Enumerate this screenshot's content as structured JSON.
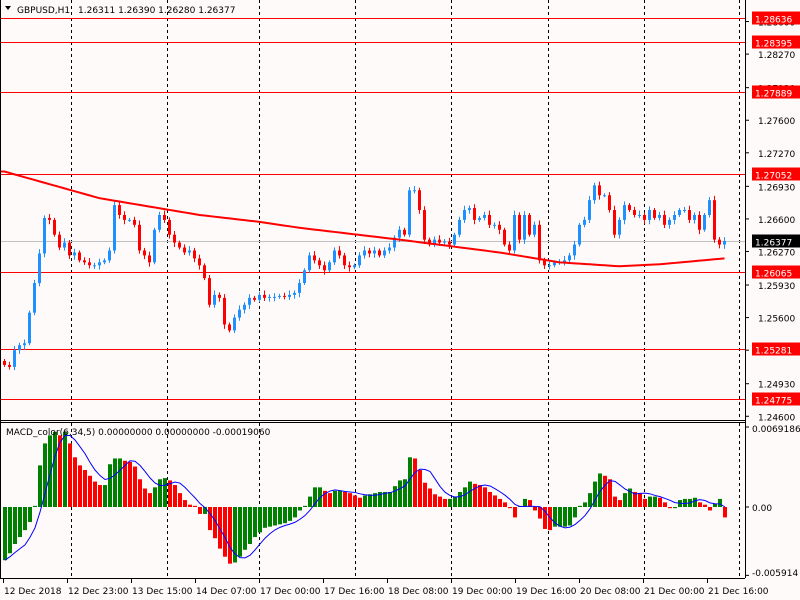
{
  "header": {
    "symbol": "GBPUSD,H1",
    "ohlc": "1.26311 1.26390 1.26280 1.26377"
  },
  "colors": {
    "background": "#fffafa",
    "bull": "#1e90ff",
    "bear": "#ff0000",
    "level": "#ff0000",
    "ma": "#ff0000",
    "macd_up": "#008000",
    "macd_down": "#ff0000",
    "signal": "#0000ff",
    "current": "#c0c0c0"
  },
  "chart_data": [
    {
      "type": "candlestick",
      "title": "GBPUSD,H1",
      "ylim": [
        1.2455,
        1.2882
      ],
      "y_ticks": [
        "1.28600",
        "1.28270",
        "1.27930",
        "1.27600",
        "1.27270",
        "1.26930",
        "1.26600",
        "1.26270",
        "1.25930",
        "1.25600",
        "1.25270",
        "1.24930",
        "1.24600"
      ],
      "x_ticks": [
        "12 Dec 2018",
        "12 Dec 23:00",
        "13 Dec 15:00",
        "14 Dec 07:00",
        "17 Dec 00:00",
        "17 Dec 16:00",
        "18 Dec 08:00",
        "19 Dec 00:00",
        "19 Dec 16:00",
        "20 Dec 08:00",
        "21 Dec 00:00",
        "21 Dec 16:00"
      ],
      "close": [
        1.2512,
        1.251,
        1.2527,
        1.2532,
        1.2534,
        1.2565,
        1.2595,
        1.2625,
        1.2661,
        1.2659,
        1.2644,
        1.2631,
        1.2636,
        1.2623,
        1.2626,
        1.2618,
        1.2616,
        1.2613,
        1.2613,
        1.2616,
        1.2618,
        1.2628,
        1.2674,
        1.2664,
        1.2659,
        1.2659,
        1.2654,
        1.2628,
        1.2623,
        1.2616,
        1.2649,
        1.2664,
        1.2659,
        1.2644,
        1.2636,
        1.2631,
        1.2626,
        1.2628,
        1.262,
        1.2613,
        1.26,
        1.2573,
        1.2583,
        1.258,
        1.2553,
        1.2547,
        1.256,
        1.2568,
        1.2573,
        1.258,
        1.2578,
        1.2583,
        1.258,
        1.2581,
        1.2581,
        1.2582,
        1.2581,
        1.2583,
        1.2585,
        1.2595,
        1.2608,
        1.2623,
        1.2618,
        1.2613,
        1.2608,
        1.2616,
        1.2628,
        1.2623,
        1.2613,
        1.2611,
        1.2613,
        1.2623,
        1.2628,
        1.2625,
        1.2628,
        1.2623,
        1.2628,
        1.2631,
        1.2641,
        1.2649,
        1.2644,
        1.2689,
        1.2689,
        1.2669,
        1.2639,
        1.2634,
        1.2639,
        1.2636,
        1.2637,
        1.2634,
        1.2644,
        1.2659,
        1.2669,
        1.2671,
        1.2659,
        1.2661,
        1.2664,
        1.2654,
        1.2654,
        1.2649,
        1.2634,
        1.2628,
        1.2664,
        1.2639,
        1.2664,
        1.2644,
        1.2654,
        1.2618,
        1.2613,
        1.2613,
        1.2616,
        1.2616,
        1.2618,
        1.2623,
        1.2634,
        1.2654,
        1.2659,
        1.2679,
        1.2694,
        1.2684,
        1.2684,
        1.2669,
        1.2644,
        1.2659,
        1.2674,
        1.2669,
        1.2664,
        1.2664,
        1.2659,
        1.2669,
        1.2661,
        1.2664,
        1.2654,
        1.2659,
        1.2664,
        1.2669,
        1.2669,
        1.2659,
        1.2664,
        1.2649,
        1.2664,
        1.2679,
        1.2639,
        1.2634,
        1.26377
      ],
      "moving_average": [
        [
          0,
          1.2708
        ],
        [
          19,
          1.2681
        ],
        [
          39,
          1.2664
        ],
        [
          51,
          1.2657
        ],
        [
          59,
          1.2651
        ],
        [
          79,
          1.2639
        ],
        [
          99,
          1.2626
        ],
        [
          111,
          1.2616
        ],
        [
          123,
          1.2612
        ],
        [
          131,
          1.2614
        ],
        [
          144,
          1.262
        ]
      ],
      "levels": [
        "1.28636",
        "1.28395",
        "1.27889",
        "1.27052",
        "1.26065",
        "1.25281",
        "1.24775"
      ],
      "current_price": "1.26377"
    },
    {
      "type": "bar",
      "title": "MACD_color(6,34,5) 0.00000000 0.00000000 -0.00019060",
      "ylim": [
        -0.005914,
        0.0069186
      ],
      "y_ticks": [
        "0.0069186",
        "0.00",
        "-0.005914"
      ],
      "histogram": [
        -0.0046,
        -0.004,
        -0.0032,
        -0.0026,
        -0.002,
        -0.0013,
        0.0001,
        0.0036,
        0.0055,
        0.0062,
        0.0065,
        0.0062,
        0.0065,
        0.0055,
        0.0043,
        0.0036,
        0.0032,
        0.0027,
        0.0022,
        0.0019,
        0.0019,
        0.0037,
        0.0042,
        0.0042,
        0.004,
        0.0039,
        0.0035,
        0.0024,
        0.0016,
        0.0012,
        0.0017,
        0.0024,
        0.0025,
        0.0023,
        0.0019,
        0.0012,
        0.0006,
        0.0002,
        0.0001,
        -0.0006,
        -0.0006,
        -0.002,
        -0.0027,
        -0.0036,
        -0.0043,
        -0.0049,
        -0.0048,
        -0.0043,
        -0.0037,
        -0.0032,
        -0.0026,
        -0.0022,
        -0.0018,
        -0.0017,
        -0.0016,
        -0.0015,
        -0.0014,
        -0.0012,
        -0.0009,
        -0.0003,
        0.0001,
        0.0009,
        0.0017,
        0.0017,
        0.0014,
        0.0012,
        0.0014,
        0.0014,
        0.0013,
        0.0012,
        0.001,
        0.0008,
        0.001,
        0.0011,
        0.0012,
        0.0013,
        0.0013,
        0.0013,
        0.0018,
        0.0023,
        0.0024,
        0.0043,
        0.0042,
        0.0032,
        0.0021,
        0.0016,
        0.0011,
        0.0009,
        0.0007,
        0.0007,
        0.0009,
        0.0013,
        0.0017,
        0.0022,
        0.002,
        0.0019,
        0.0017,
        0.0013,
        0.001,
        0.0007,
        0.0004,
        -0.0001,
        -0.0009,
        0.0001,
        0.0007,
        0.0006,
        -0.0003,
        -0.001,
        -0.0019,
        -0.002,
        -0.0017,
        -0.0017,
        -0.0017,
        -0.0016,
        -0.0009,
        0.0001,
        0.0004,
        0.0012,
        0.0022,
        0.0029,
        0.0027,
        0.0024,
        0.0009,
        0.0006,
        0.0012,
        0.0016,
        0.0013,
        0.0012,
        0.0007,
        0.0009,
        0.0009,
        0.0008,
        0.0004,
        -0.0001,
        -0.0001,
        0.0006,
        0.0007,
        0.0007,
        0.0008,
        0.0004,
        0.0002,
        -0.0003,
        0.0003,
        0.0007,
        -0.0009
      ]
    }
  ]
}
